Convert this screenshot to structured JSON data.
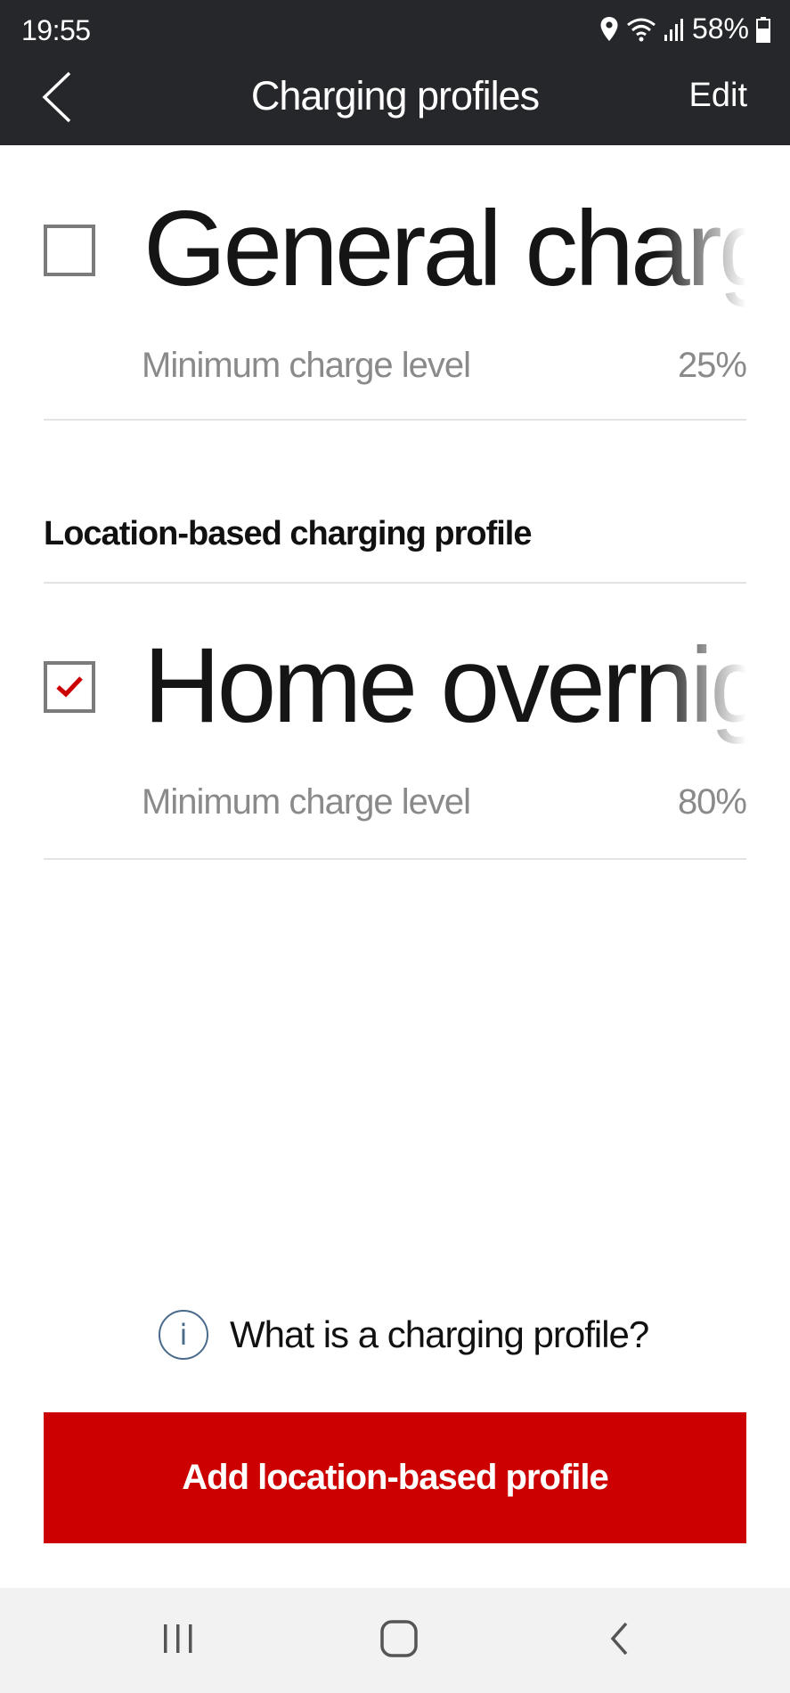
{
  "status_bar": {
    "time": "19:55",
    "battery": "58%",
    "icons": [
      "location-icon",
      "wifi-icon",
      "signal-icon",
      "battery-icon"
    ]
  },
  "header": {
    "title": "Charging profiles",
    "edit_label": "Edit",
    "back_icon": "chevron-left-icon"
  },
  "profiles": {
    "general": {
      "name": "General charging",
      "checked": false,
      "min_label": "Minimum charge level",
      "min_value": "25%"
    },
    "section_title": "Location-based charging profile",
    "location": [
      {
        "name": "Home overnight",
        "checked": true,
        "min_label": "Minimum charge level",
        "min_value": "80%"
      }
    ]
  },
  "info_link": {
    "icon": "info-icon",
    "label": "What is a charging profile?"
  },
  "primary_button": {
    "label": "Add location-based profile"
  },
  "colors": {
    "header_bg": "#26272b",
    "accent": "#cc0000",
    "muted_text": "#8a8a8a"
  },
  "nav_bar": {
    "icons": [
      "recents-icon",
      "home-icon",
      "back-icon"
    ]
  }
}
